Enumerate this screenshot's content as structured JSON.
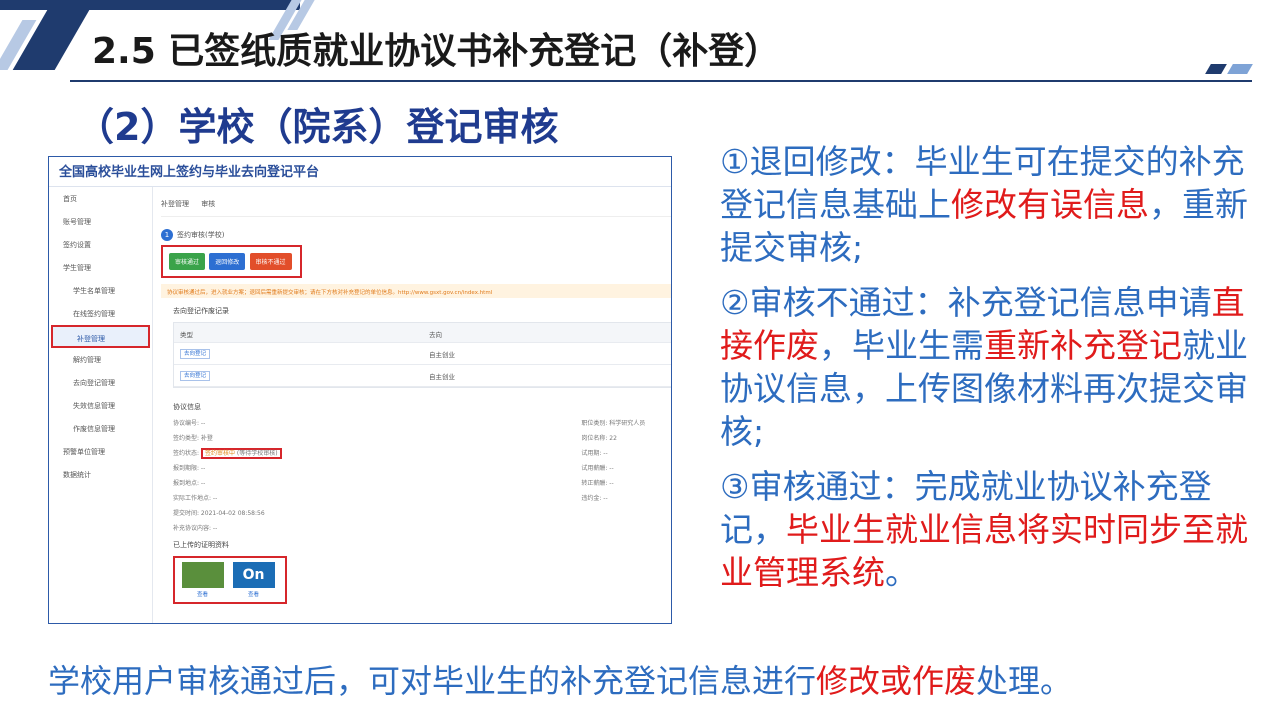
{
  "slide": {
    "title": "2.5 已签纸质就业协议书补充登记（补登）",
    "subtitle": "（2）学校（院系）登记审核",
    "footer_pre": "学校用户审核通过后，可对毕业生的补充登记信息进行",
    "footer_hl": "修改或作废",
    "footer_post": "处理。"
  },
  "notes": [
    {
      "pre": "①退回修改：毕业生可在提交的补充登记信息基础上",
      "hl": "修改有误信息",
      "post": "，重新提交审核;"
    },
    {
      "pre": "②审核不通过：补充登记信息申请",
      "hl": "直接作废",
      "mid": "，毕业生需",
      "hl2": "重新补充登记",
      "post": "就业协议信息，上传图像材料再次提交审核;"
    },
    {
      "pre": "③审核通过：完成就业协议补充登记，",
      "hl": "毕业生就业信息将实时同步至就业管理系统",
      "post": "。"
    }
  ],
  "screenshot": {
    "platform_title": "全国高校毕业生网上签约与毕业去向登记平台",
    "sidebar": [
      "首页",
      "账号管理",
      "签约设置",
      "学生管理",
      "学生名单管理",
      "在线签约管理",
      "补登管理",
      "解约管理",
      "去向登记管理",
      "失效信息管理",
      "作废信息管理",
      "预警单位管理",
      "数据统计"
    ],
    "breadcrumbs": [
      "补登管理",
      "审核"
    ],
    "step_label": "签约审核(学校)",
    "step_num": "1",
    "buttons": [
      "审核通过",
      "退回修改",
      "审核不通过"
    ],
    "notice": "协议审核通过后，进入就业方案；退回后需重新提交审核；请在下方核对补充登记的单位信息。http://www.gsxt.gov.cn/index.html",
    "record_section": "去向登记作废记录",
    "table_head": [
      "类型",
      "去向"
    ],
    "table_rows": [
      [
        "去向登记",
        "自主创业"
      ],
      [
        "去向登记",
        "自主创业"
      ]
    ],
    "info_section": "协议信息",
    "info_left": [
      "协议编号: --",
      "签约类型: 补登",
      "签约状态:",
      "报到期限: --",
      "报到地点: --",
      "实际工作地点: --",
      "提交时间: 2021-04-02 08:58:56",
      "补充协议内容: --"
    ],
    "status_val": "签约审核中",
    "status_note": "(等待学校审核)",
    "info_right": [
      "职位类别: 科学研究人员",
      "岗位名称: 22",
      "试用期: --",
      "试用薪酬: --",
      "转正薪酬: --",
      "违约金: --"
    ],
    "materials_label": "已上传的证明资料",
    "thumb_label": "查看",
    "thumb2_text": "On"
  }
}
